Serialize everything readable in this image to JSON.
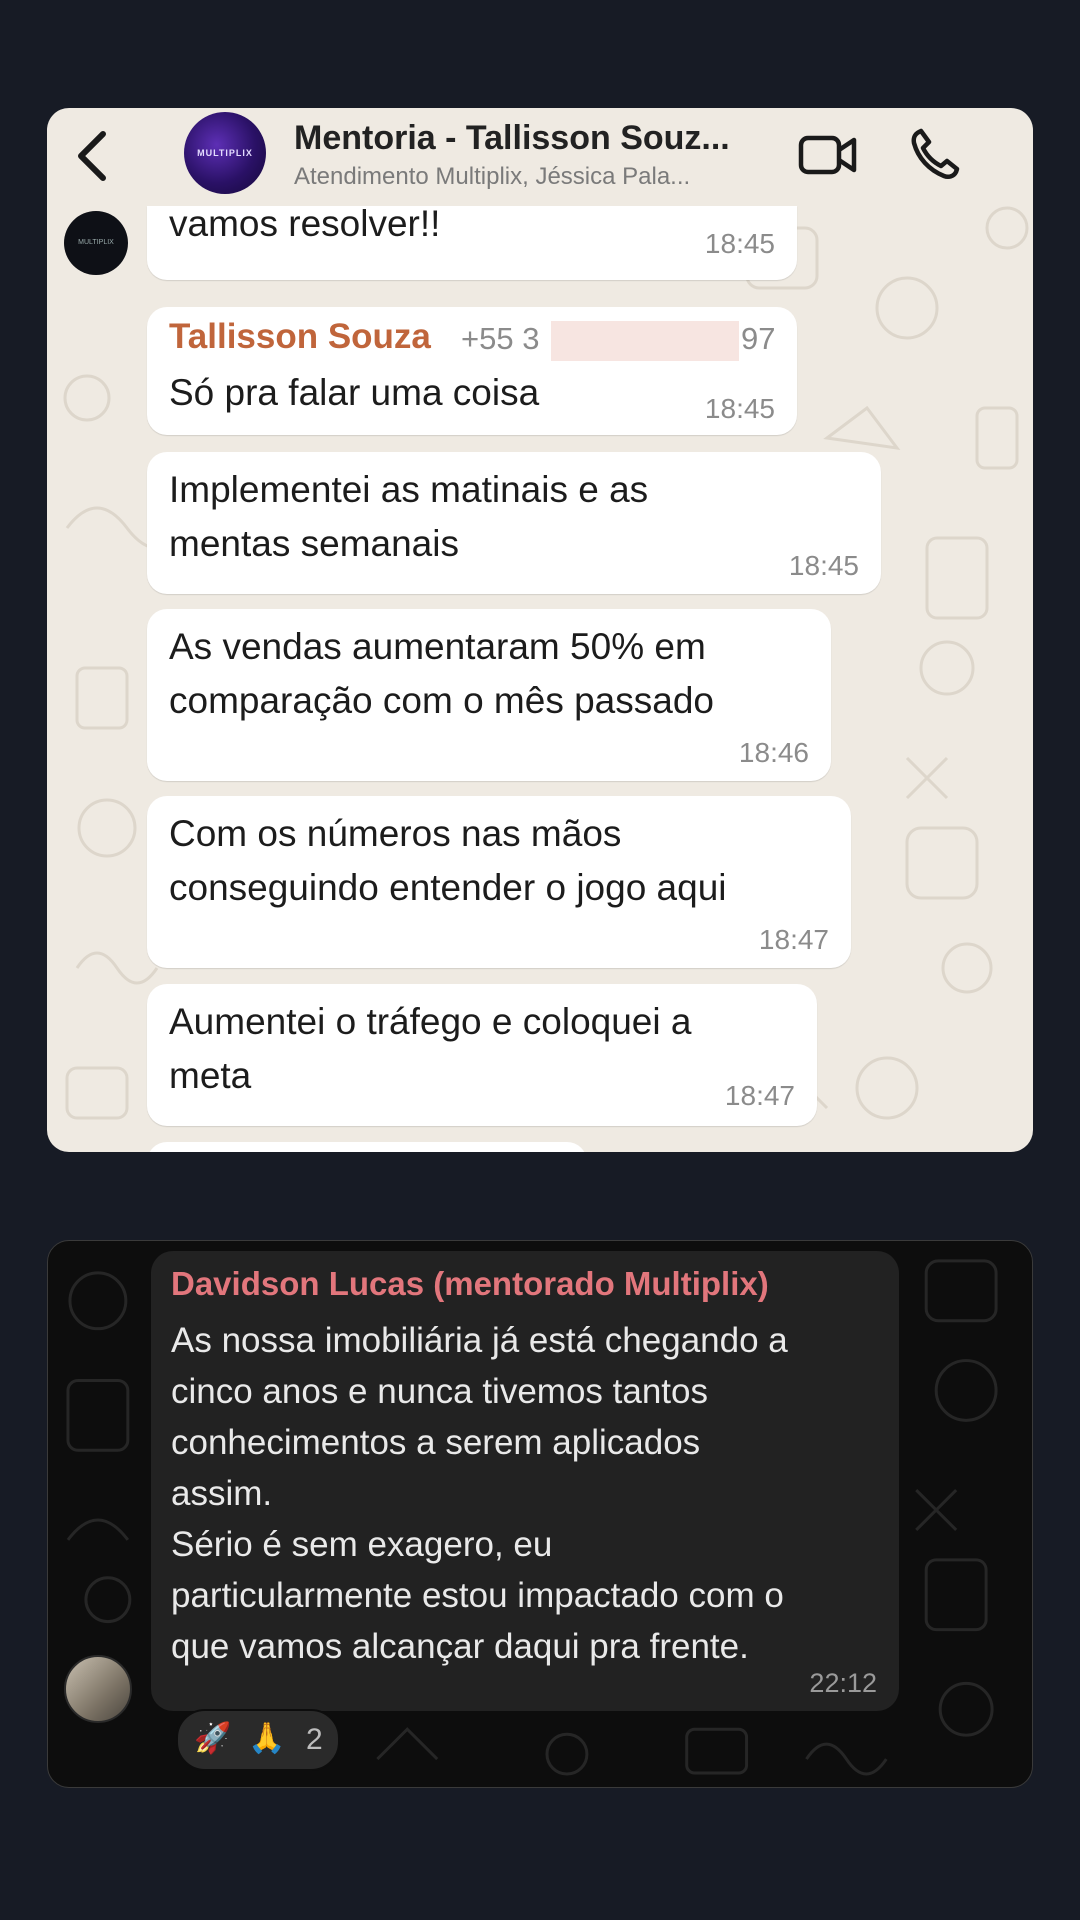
{
  "chat_light": {
    "header": {
      "title": "Mentoria - Tallisson Souz...",
      "subtitle": "Atendimento Multiplix, Jéssica Pala..."
    },
    "messages": [
      {
        "text": "vamos resolver!!",
        "time": "18:45"
      },
      {
        "sender": "Tallisson Souza",
        "phone_prefix": "+55 3",
        "phone_suffix": "97",
        "text": "Só pra falar uma coisa",
        "time": "18:45"
      },
      {
        "lines": [
          "Implementei as matinais e as",
          "mentas semanais"
        ],
        "time": "18:45"
      },
      {
        "lines": [
          "As vendas aumentaram 50% em",
          "comparação com o mês passado"
        ],
        "time": "18:46"
      },
      {
        "lines": [
          "Com os números nas mãos",
          "conseguindo entender o jogo aqui"
        ],
        "time": "18:47"
      },
      {
        "lines": [
          "Aumentei o tráfego e coloquei a",
          "meta"
        ],
        "time": "18:47"
      }
    ]
  },
  "chat_dark": {
    "message": {
      "sender": "Davidson Lucas (mentorado Multiplix)",
      "lines": [
        "As nossa imobiliária já está chegando a",
        "cinco anos e nunca tivemos tantos",
        "conhecimentos a serem aplicados",
        "assim.",
        "Sério é sem exagero, eu",
        "particularmente estou impactado com o",
        "que vamos alcançar daqui pra frente."
      ],
      "time": "22:12"
    },
    "reactions": {
      "emoji_1": "🚀",
      "emoji_2": "🙏",
      "count": "2"
    }
  },
  "colors": {
    "page_bg": "#171b25",
    "light_chat_bg": "#efeae2",
    "dark_chat_bg": "#0d0d0d",
    "sender_light": "#c0653b",
    "sender_dark": "#e2767c"
  },
  "icons": [
    "back-chevron-icon",
    "video-call-icon",
    "phone-call-icon"
  ]
}
